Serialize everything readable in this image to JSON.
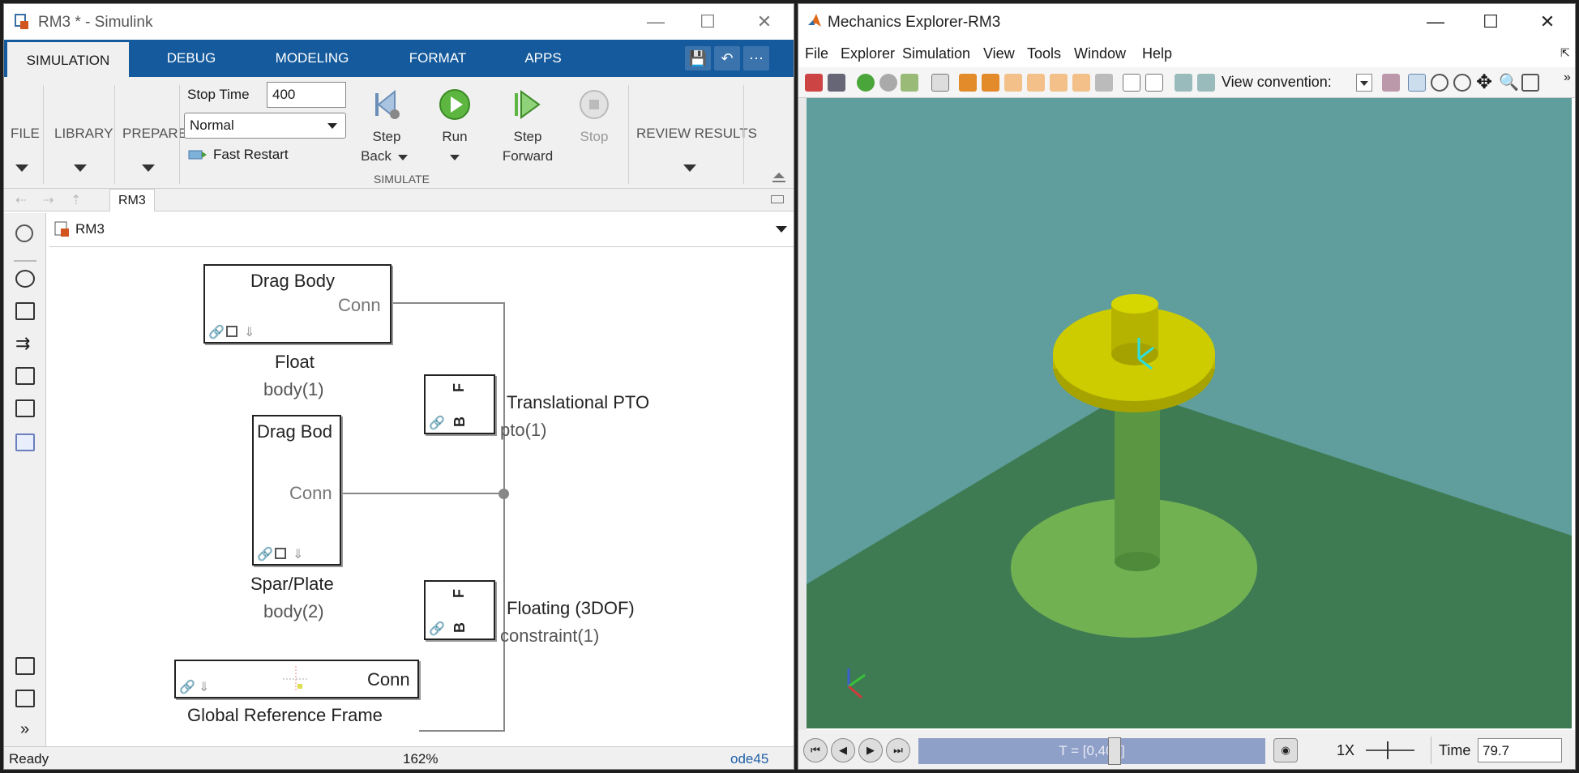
{
  "simulink": {
    "title": "RM3 * - Simulink",
    "tabs": [
      "SIMULATION",
      "DEBUG",
      "MODELING",
      "FORMAT",
      "APPS"
    ],
    "ribbon": {
      "file": "FILE",
      "library": "LIBRARY",
      "prepare": "PREPARE",
      "stop_time_label": "Stop Time",
      "stop_time_value": "400",
      "mode": "Normal",
      "fast_restart": "Fast Restart",
      "step_back_1": "Step",
      "step_back_2": "Back",
      "run": "Run",
      "step_forward_1": "Step",
      "step_forward_2": "Forward",
      "stop": "Stop",
      "simulate_group": "SIMULATE",
      "review_results": "REVIEW RESULTS"
    },
    "breadcrumb_tab": "RM3",
    "path": "RM3",
    "blocks": {
      "float_title": "Drag Body",
      "float_conn": "Conn",
      "float_name": "Float",
      "float_sub": "body(1)",
      "spar_title": "Drag Bod",
      "spar_conn": "Conn",
      "spar_name": "Spar/Plate",
      "spar_sub": "body(2)",
      "pto_f": "F",
      "pto_b": "B",
      "pto_name": "Translational PTO",
      "pto_sub": "pto(1)",
      "con_f": "F",
      "con_b": "B",
      "con_name": "Floating (3DOF)",
      "con_sub": "constraint(1)",
      "grf_conn": "Conn",
      "grf_name": "Global Reference Frame"
    },
    "status": {
      "left": "Ready",
      "zoom": "162%",
      "solver": "ode45"
    }
  },
  "mechanics": {
    "title": "Mechanics Explorer-RM3",
    "menu": [
      "File",
      "Explorer",
      "Simulation",
      "View",
      "Tools",
      "Window",
      "Help"
    ],
    "view_convention_label": "View convention:",
    "timeline_text": "T = [0,400]",
    "speed": "1X",
    "time_label": "Time",
    "time_value": "79.7",
    "colors": {
      "sky": "#5f9e9d",
      "floor": "#3e7b52",
      "plate": "#72b152",
      "float": "#cccc00"
    }
  }
}
